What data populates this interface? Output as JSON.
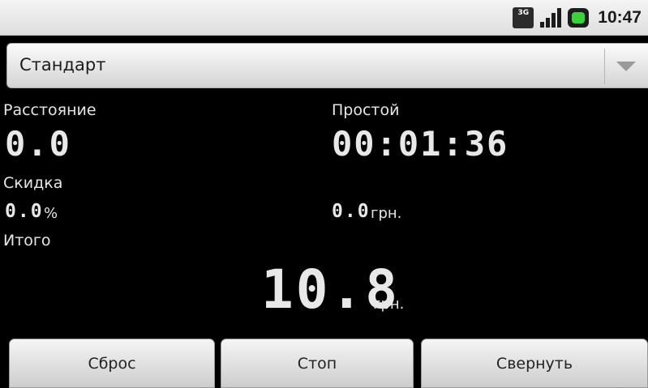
{
  "status_bar": {
    "network": "3G",
    "time": "10:47"
  },
  "tariff": {
    "selected": "Стандарт"
  },
  "distance": {
    "label": "Расстояние",
    "value": "0.0"
  },
  "idle": {
    "label": "Простой",
    "value": "00:01:36"
  },
  "discount": {
    "label": "Скидка",
    "percent_value": "0.0",
    "percent_unit": "%",
    "amount_value": "0.0",
    "amount_unit": "грн."
  },
  "total": {
    "label": "Итого",
    "value": "10.8",
    "unit": "грн."
  },
  "buttons": {
    "reset": "Сброс",
    "stop": "Стоп",
    "minimize": "Свернуть"
  }
}
